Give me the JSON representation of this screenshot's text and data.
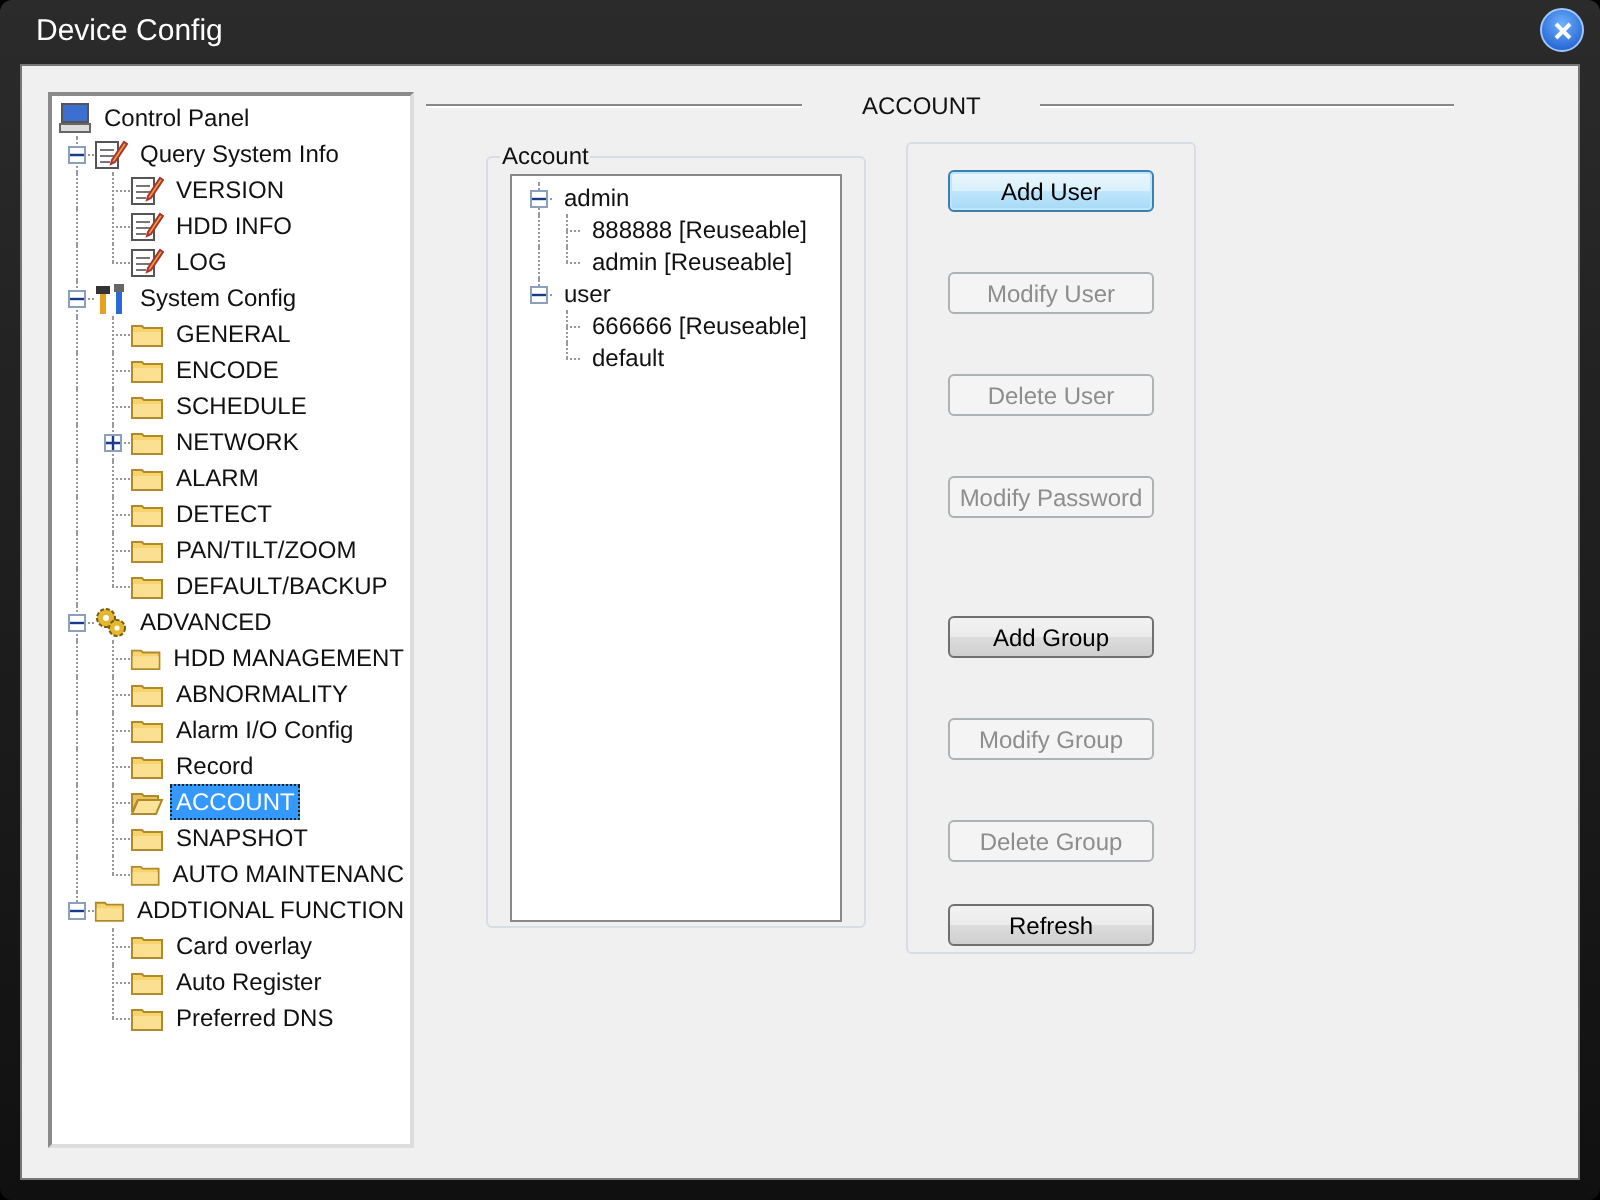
{
  "window": {
    "title": "Device Config"
  },
  "nav_tree": [
    {
      "label": "Control Panel",
      "kind": "monitor",
      "selected": false,
      "children": [
        {
          "label": "Query System Info",
          "kind": "notepad",
          "toggle": true,
          "expanded": true,
          "selected": false,
          "children": [
            {
              "label": "VERSION",
              "kind": "notepad",
              "toggle": false,
              "expanded": false,
              "selected": false
            },
            {
              "label": "HDD INFO",
              "kind": "notepad",
              "toggle": false,
              "expanded": false,
              "selected": false
            },
            {
              "label": "LOG",
              "kind": "notepad",
              "toggle": false,
              "expanded": false,
              "selected": false
            }
          ]
        },
        {
          "label": "System Config",
          "kind": "tools",
          "toggle": true,
          "expanded": true,
          "selected": false,
          "children": [
            {
              "label": "GENERAL",
              "kind": "folder",
              "toggle": false,
              "expanded": false,
              "selected": false
            },
            {
              "label": "ENCODE",
              "kind": "folder",
              "toggle": false,
              "expanded": false,
              "selected": false
            },
            {
              "label": "SCHEDULE",
              "kind": "folder",
              "toggle": false,
              "expanded": false,
              "selected": false
            },
            {
              "label": "NETWORK",
              "kind": "folder",
              "toggle": true,
              "expanded": false,
              "selected": false
            },
            {
              "label": "ALARM",
              "kind": "folder",
              "toggle": false,
              "expanded": false,
              "selected": false
            },
            {
              "label": "DETECT",
              "kind": "folder",
              "toggle": false,
              "expanded": false,
              "selected": false
            },
            {
              "label": "PAN/TILT/ZOOM",
              "kind": "folder",
              "toggle": false,
              "expanded": false,
              "selected": false
            },
            {
              "label": "DEFAULT/BACKUP",
              "kind": "folder",
              "toggle": false,
              "expanded": false,
              "selected": false
            }
          ]
        },
        {
          "label": "ADVANCED",
          "kind": "gears",
          "toggle": true,
          "expanded": true,
          "selected": false,
          "children": [
            {
              "label": "HDD MANAGEMENT",
              "kind": "folder",
              "toggle": false,
              "expanded": false,
              "selected": false
            },
            {
              "label": "ABNORMALITY",
              "kind": "folder",
              "toggle": false,
              "expanded": false,
              "selected": false
            },
            {
              "label": "Alarm I/O Config",
              "kind": "folder",
              "toggle": false,
              "expanded": false,
              "selected": false
            },
            {
              "label": "Record",
              "kind": "folder",
              "toggle": false,
              "expanded": false,
              "selected": false
            },
            {
              "label": "ACCOUNT",
              "kind": "folder",
              "toggle": false,
              "expanded": false,
              "selected": true
            },
            {
              "label": "SNAPSHOT",
              "kind": "folder",
              "toggle": false,
              "expanded": false,
              "selected": false
            },
            {
              "label": "AUTO MAINTENANC",
              "kind": "folder",
              "toggle": false,
              "expanded": false,
              "selected": false
            }
          ]
        },
        {
          "label": "ADDTIONAL FUNCTION",
          "kind": "folder",
          "toggle": true,
          "expanded": true,
          "selected": false,
          "children": [
            {
              "label": "Card overlay",
              "kind": "folder",
              "toggle": false,
              "expanded": false,
              "selected": false
            },
            {
              "label": "Auto Register",
              "kind": "folder",
              "toggle": false,
              "expanded": false,
              "selected": false
            },
            {
              "label": "Preferred DNS",
              "kind": "folder",
              "toggle": false,
              "expanded": false,
              "selected": false
            }
          ]
        }
      ]
    }
  ],
  "section_title": "ACCOUNT",
  "account_group": {
    "label": "Account",
    "tree": [
      {
        "label": "admin",
        "toggle": true,
        "expanded": true,
        "selected": false,
        "children": [
          {
            "label": "888888 [Reuseable]",
            "toggle": false,
            "expanded": false,
            "selected": false
          },
          {
            "label": "admin [Reuseable]",
            "toggle": false,
            "expanded": false,
            "selected": false
          }
        ]
      },
      {
        "label": "user",
        "toggle": true,
        "expanded": true,
        "selected": false,
        "children": [
          {
            "label": "666666 [Reuseable]",
            "toggle": false,
            "expanded": false,
            "selected": false
          },
          {
            "label": "default",
            "toggle": false,
            "expanded": false,
            "selected": false
          }
        ]
      }
    ]
  },
  "buttons": [
    {
      "label": "Add User",
      "disabled": false,
      "focused": true
    },
    {
      "label": "Modify User",
      "disabled": true,
      "focused": false
    },
    {
      "label": "Delete User",
      "disabled": true,
      "focused": false
    },
    {
      "label": "Modify Password",
      "disabled": true,
      "focused": false
    },
    {
      "label": "Add Group",
      "disabled": false,
      "focused": false
    },
    {
      "label": "Modify Group",
      "disabled": true,
      "focused": false
    },
    {
      "label": "Delete Group",
      "disabled": true,
      "focused": false
    },
    {
      "label": "Refresh",
      "disabled": false,
      "focused": false
    }
  ]
}
